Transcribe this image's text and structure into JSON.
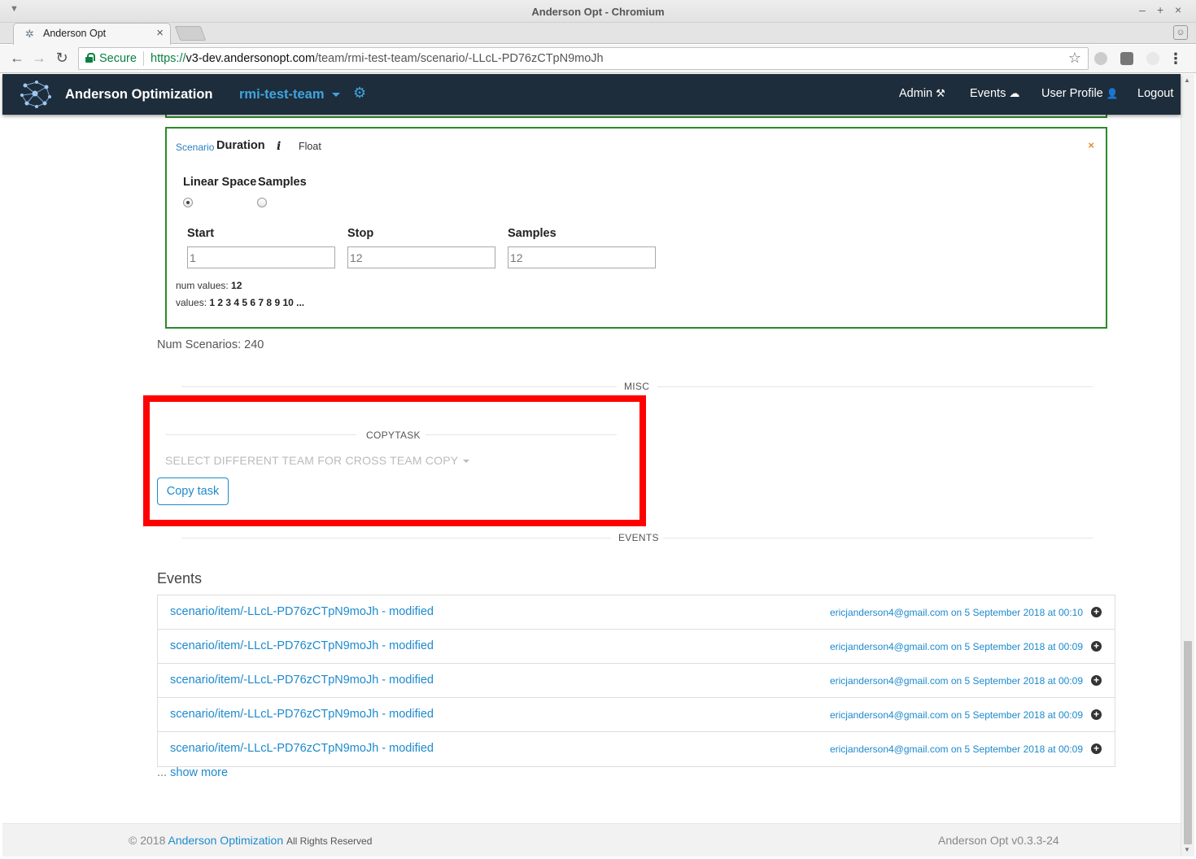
{
  "window": {
    "title": "Anderson Opt - Chromium"
  },
  "tab": {
    "title": "Anderson Opt",
    "close": "×"
  },
  "address_bar": {
    "secure_label": "Secure",
    "url_scheme": "https://",
    "url_host": "v3-dev.andersonopt.com",
    "url_path": "/team/rmi-test-team/scenario/-LLcL-PD76zCTpN9moJh"
  },
  "navbar": {
    "brand": "Anderson Optimization",
    "team": "rmi-test-team",
    "links": [
      {
        "label": "Admin",
        "icon": "tools-icon",
        "glyph": "⚒"
      },
      {
        "label": "Events",
        "icon": "cloud-icon",
        "glyph": "☁"
      },
      {
        "label": "User Profile",
        "icon": "user-icon",
        "glyph": "👤"
      },
      {
        "label": "Logout"
      }
    ]
  },
  "parameter": {
    "kind": "Scenario",
    "name": "Duration",
    "info_glyph": "i",
    "type": "Float",
    "close_glyph": "×",
    "modes": [
      {
        "label": "Linear Space",
        "selected": true
      },
      {
        "label": "Samples",
        "selected": false
      }
    ],
    "fields": [
      {
        "label": "Start",
        "value": "1"
      },
      {
        "label": "Stop",
        "value": "12"
      },
      {
        "label": "Samples",
        "value": "12"
      }
    ],
    "num_values_label": "num values:",
    "num_values": "12",
    "values_label": "values:",
    "values": "1 2 3 4 5 6 7 8 9 10 ..."
  },
  "num_scenarios": "Num Scenarios: 240",
  "sections": {
    "misc": "MISC",
    "copytask": "COPYTASK",
    "events": "EVENTS"
  },
  "copytask": {
    "team_select": "SELECT DIFFERENT TEAM FOR CROSS TEAM COPY",
    "copy_button": "Copy task"
  },
  "events": {
    "heading": "Events",
    "items": [
      {
        "path": "scenario/item/-LLcL-PD76zCTpN9moJh - modified",
        "meta": "ericjanderson4@gmail.com on 5 September 2018 at 00:10"
      },
      {
        "path": "scenario/item/-LLcL-PD76zCTpN9moJh - modified",
        "meta": "ericjanderson4@gmail.com on 5 September 2018 at 00:09"
      },
      {
        "path": "scenario/item/-LLcL-PD76zCTpN9moJh - modified",
        "meta": "ericjanderson4@gmail.com on 5 September 2018 at 00:09"
      },
      {
        "path": "scenario/item/-LLcL-PD76zCTpN9moJh - modified",
        "meta": "ericjanderson4@gmail.com on 5 September 2018 at 00:09"
      },
      {
        "path": "scenario/item/-LLcL-PD76zCTpN9moJh - modified",
        "meta": "ericjanderson4@gmail.com on 5 September 2018 at 00:09"
      }
    ],
    "show_more_prefix": "...",
    "show_more": "show more"
  },
  "footer": {
    "copyright": "© 2018",
    "org": "Anderson Optimization",
    "rights": "All Rights Reserved",
    "version": "Anderson Opt v0.3.3-24"
  },
  "colors": {
    "navbar_bg": "#1e2d3b",
    "accent": "#1d8acd",
    "team_link": "#3fa4df",
    "param_border": "#2b8a2b",
    "highlight": "#ff0000"
  }
}
